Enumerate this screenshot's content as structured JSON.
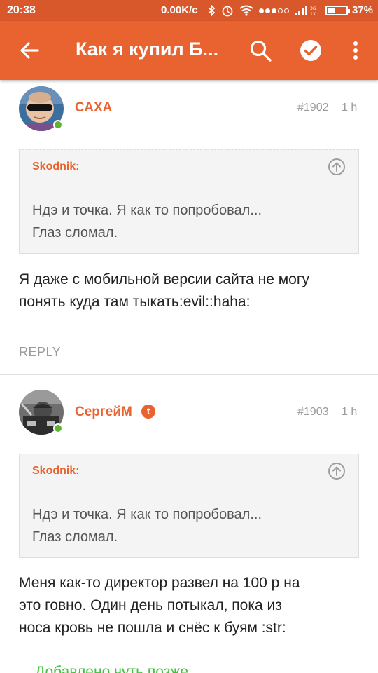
{
  "status_bar": {
    "time": "20:38",
    "network_speed": "0.00K/c",
    "battery": "37%",
    "battery_level": 0.37
  },
  "app_bar": {
    "title": "Как я купил Б...",
    "icons": [
      "back-arrow-icon",
      "search-icon",
      "check-circle-icon",
      "more-vertical-icon"
    ],
    "color": "#e8632f"
  },
  "comments": [
    {
      "author": "САХА",
      "number": "#1902",
      "time": "1 h",
      "online": true,
      "quote": {
        "author": "Skodnik:",
        "line1": "Ндэ и точка. Я как то попробовал...",
        "line2": "Глаз сломал."
      },
      "body_line1": "Я даже с мобильной версии сайта не могу",
      "body_line2": "понять куда там тыкать:evil::haha:",
      "reply_label": "REPLY"
    },
    {
      "author": "СергейМ",
      "badge": "t",
      "number": "#1903",
      "time": "1 h",
      "online": true,
      "quote": {
        "author": "Skodnik:",
        "line1": "Ндэ и точка. Я как то попробовал...",
        "line2": "Глаз сломал."
      },
      "body_line1": "Меня как-то директор развел на 100 р на",
      "body_line2": "это говно. Один день потыкал, пока из",
      "body_line3": "носа кровь не пошла и снёс к буям :str:",
      "edited_note": "Добавлено чуть позже"
    }
  ],
  "colors": {
    "accent": "#e8632f",
    "online": "#5fb531",
    "edited": "#3cc43c"
  }
}
